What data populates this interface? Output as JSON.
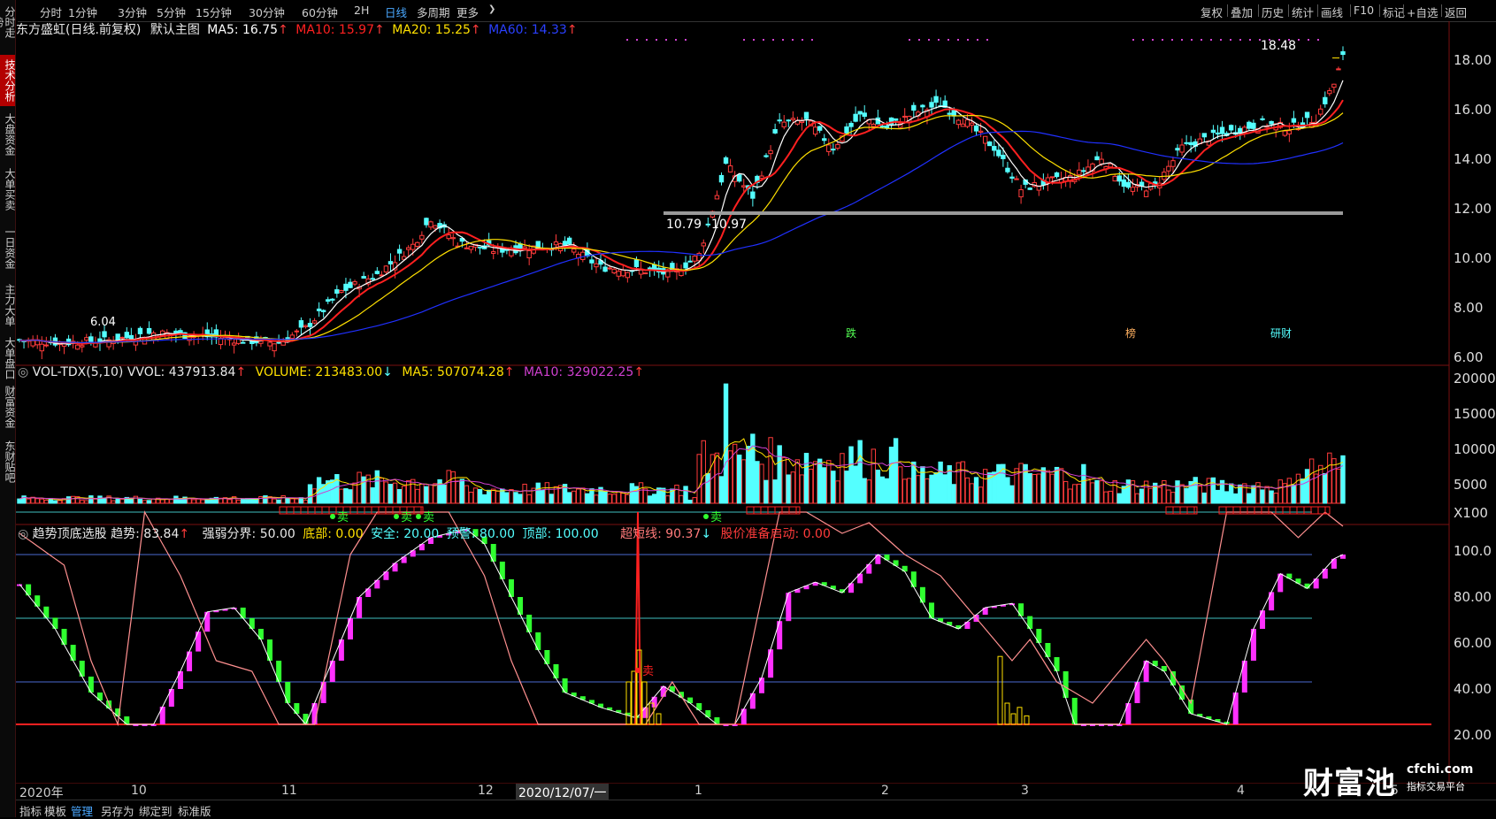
{
  "sidebar": {
    "items": [
      {
        "label": "分时走势"
      },
      {
        "label": "技术分析",
        "active": true
      },
      {
        "label": "大盘资金"
      },
      {
        "label": "大单买卖"
      },
      {
        "label": "一日资金"
      },
      {
        "label": "主力大单"
      },
      {
        "label": "大单盘口"
      },
      {
        "label": "财富资金"
      },
      {
        "label": "东财贴吧"
      }
    ]
  },
  "toolbar": {
    "left": [
      "分时",
      "1分钟",
      "3分钟",
      "5分钟",
      "15分钟",
      "30分钟",
      "60分钟",
      "2H",
      "日线",
      "多周期",
      "更多"
    ],
    "active": "日线",
    "more_arrow": "❯",
    "right": [
      "复权",
      "叠加",
      "历史",
      "统计",
      "画线",
      "F10",
      "标记",
      "+自选",
      "返回"
    ]
  },
  "main_chart": {
    "stock": "东方盛虹",
    "mode": "(日线.前复权)",
    "template": "默认主图",
    "ma5": "MA5: 16.75",
    "ma10": "MA10: 15.97",
    "ma20": "MA20: 15.25",
    "ma60": "MA60: 14.33",
    "up_arrow": "↑",
    "y_ticks": [
      "18.00",
      "16.00",
      "14.00",
      "12.00",
      "10.00",
      "8.00",
      "6.00"
    ],
    "high_label": "18.48",
    "support_label_a": "10.79",
    "support_label_b": "10.97",
    "low_label": "6.04",
    "events": [
      "跌",
      "榜",
      "研财"
    ]
  },
  "vol_chart": {
    "name": "VOL-TDX(5,10)",
    "vvol": "VVOL: 437913.84",
    "volume": "VOLUME: 213483.00",
    "ma5": "MA5: 507074.28",
    "ma10": "MA10: 329022.25",
    "down_arrow": "↓",
    "y_ticks": [
      "20000",
      "15000",
      "10000",
      "5000",
      "X100"
    ]
  },
  "ind_chart": {
    "name": "趋势顶底选股",
    "trend": "趋势: 83.84",
    "strong_weak": "强弱分界: 50.00",
    "bottom": "底部: 0.00",
    "safe": "安全: 20.00",
    "warn": "预警: 80.00",
    "top": "顶部: 100.00",
    "short": "超短线: 90.37",
    "start": "股价准备启动: 0.00",
    "y_ticks": [
      "100.0",
      "80.00",
      "60.00",
      "40.00",
      "20.00"
    ],
    "sell_label": "卖"
  },
  "x_axis": {
    "labels": [
      "2020年",
      "10",
      "11",
      "12",
      "2020/12/07/一",
      "1",
      "2",
      "3",
      "4",
      "5"
    ]
  },
  "bottom_bar": {
    "items": [
      "指标",
      "模板",
      "管理",
      "另存为",
      "绑定到",
      "标准版"
    ],
    "active": "管理"
  },
  "watermark": {
    "brand": "财富池",
    "domain": "cfchi.com",
    "tagline": "指标交易平台"
  },
  "colors": {
    "up": "#ff3b3b",
    "down": "#54ffff",
    "ma5": "#ffffff",
    "ma10": "#ff2020",
    "ma20": "#ffe000",
    "ma60": "#2030ff",
    "vol_ma10": "#d040d0"
  }
}
